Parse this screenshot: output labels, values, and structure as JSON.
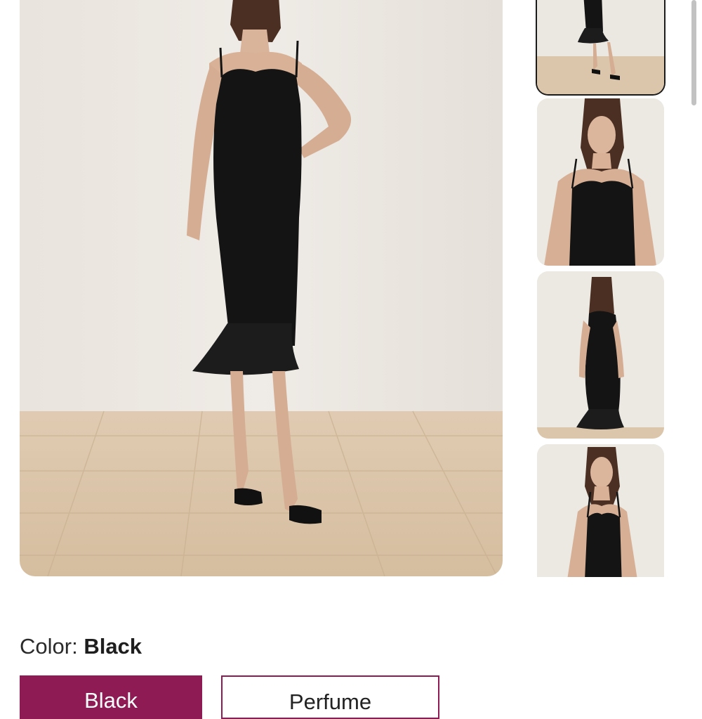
{
  "product": {
    "main_image_alt": "Model wearing black midi slip dress with ruffle hem",
    "thumbnails": [
      {
        "name": "thumb-full-front",
        "selected": true
      },
      {
        "name": "thumb-closeup-front",
        "selected": false
      },
      {
        "name": "thumb-back",
        "selected": false
      },
      {
        "name": "thumb-side",
        "selected": false
      }
    ]
  },
  "color": {
    "label": "Color:",
    "selected_value": "Black",
    "options": [
      "Black",
      "Perfume"
    ]
  },
  "colors": {
    "accent": "#8e1b54",
    "dress": "#141414",
    "wall": "#ece8e2",
    "floor": "#d9c2a6"
  }
}
